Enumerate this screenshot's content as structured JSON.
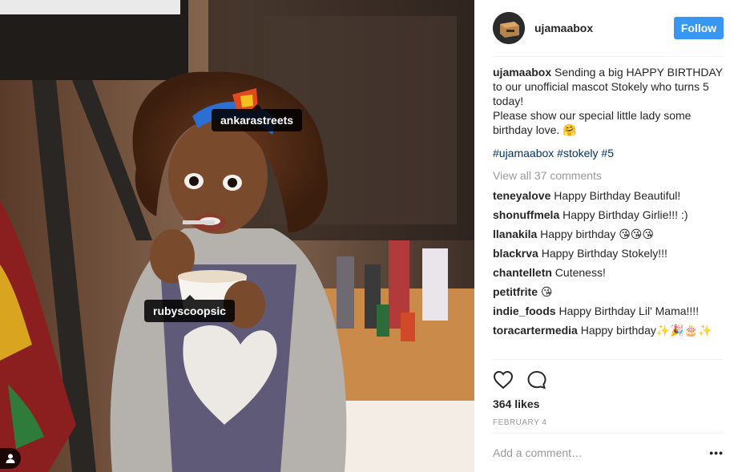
{
  "photo": {
    "tags": [
      "ankarastreets",
      "rubyscoopsic"
    ]
  },
  "header": {
    "username": "ujamaabox",
    "follow_label": "Follow"
  },
  "caption": {
    "username": "ujamaabox",
    "text_1": " Sending a big HAPPY BIRTHDAY to our unofficial mascot Stokely who turns 5 today!",
    "text_2": "Please show our special little lady some birthday love. 🤗"
  },
  "hashtags": [
    "#ujamaabox",
    "#stokely",
    "#5"
  ],
  "view_all_label": "View all 37 comments",
  "comments": [
    {
      "user": "teneyalove",
      "text": " Happy Birthday Beautiful!"
    },
    {
      "user": "shonuffmela",
      "text": " Happy Birthday Girlie!!! :)"
    },
    {
      "user": "llanakila",
      "text": " Happy birthday 😘😘😘"
    },
    {
      "user": "blackrva",
      "text": " Happy Birthday Stokely!!!"
    },
    {
      "user": "chantelletn",
      "text": " Cuteness!"
    },
    {
      "user": "petitfrite",
      "text": " 😘"
    },
    {
      "user": "indie_foods",
      "text": " Happy Birthday Lil' Mama!!!!"
    },
    {
      "user": "toracartermedia",
      "text": " Happy birthday✨🎉🎂✨"
    }
  ],
  "actions": {
    "like_icon": "heart-icon",
    "comment_icon": "comment-bubble-icon"
  },
  "likes": "364 likes",
  "date": "FEBRUARY 4",
  "add_comment": {
    "placeholder": "Add a comment…",
    "more_label": "•••"
  },
  "colors": {
    "follow": "#3897f0",
    "hashtag": "#003569",
    "muted": "#999999"
  }
}
